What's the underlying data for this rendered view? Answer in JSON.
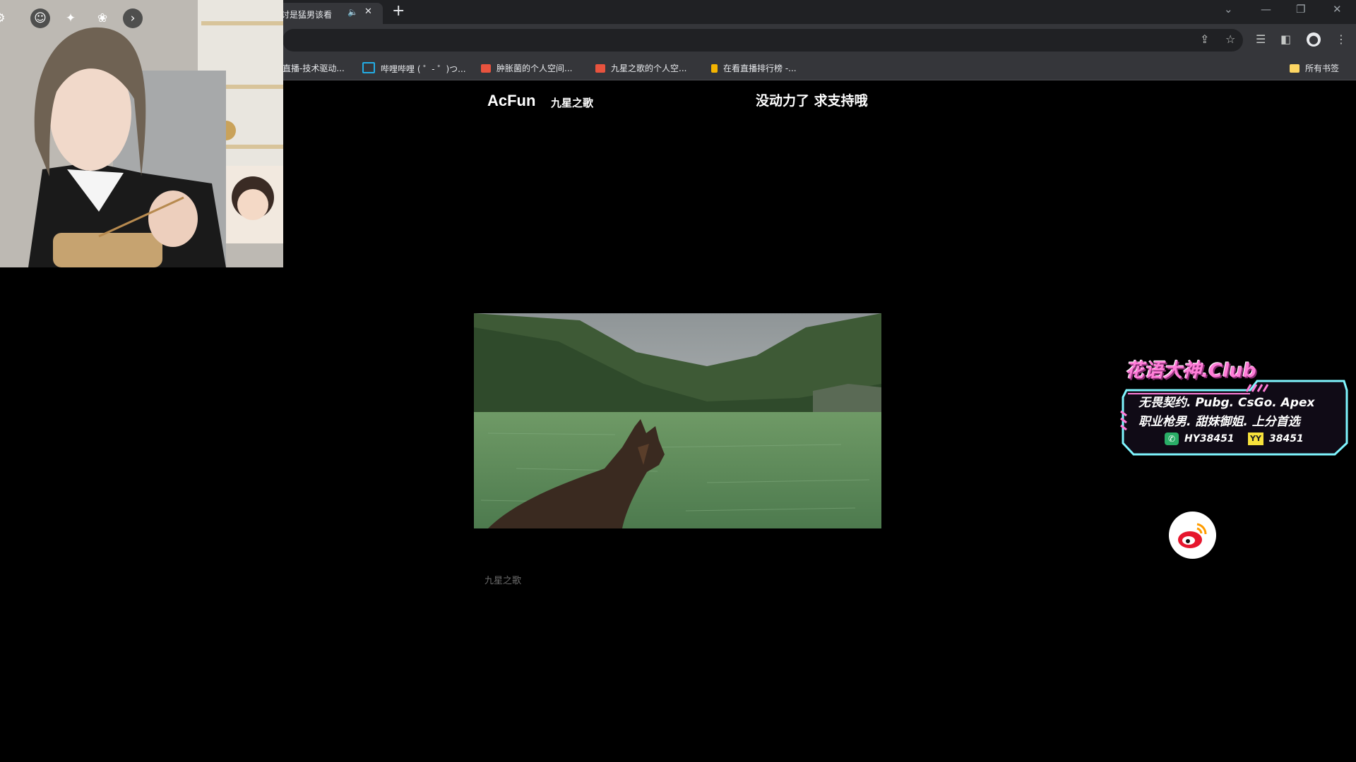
{
  "browser": {
    "tab_title": "讨是猛男该看",
    "tab_audio_icon": "speaker-icon",
    "new_tab_label": "+",
    "window_controls": [
      "⌄",
      "—",
      "❐",
      "✕"
    ]
  },
  "bookmarks": [
    {
      "label": "直播-技术驱动...",
      "color": "#e53935"
    },
    {
      "label": "哔哩哔哩 ( ゜- ゜)つ...",
      "color": "#23ade5"
    },
    {
      "label": "肿胀菌的个人空间...",
      "color": "#e8533e"
    },
    {
      "label": "九星之歌的个人空...",
      "color": "#e8533e"
    },
    {
      "label": "在看直播排行榜 -...",
      "color": "#f4b400"
    }
  ],
  "all_bookmarks_label": "所有书签",
  "page": {
    "logo_text": "AcFun",
    "logo_sub": "九星之歌",
    "headline": "没动力了 求支持哦",
    "credit": "九星之歌"
  },
  "promo": {
    "title": "花语大神.Club",
    "line1": "无畏契约. Pubg. CsGo. Apex",
    "line2": "职业枪男. 甜妹御姐. 上分首选",
    "wechat_id": "HY38451",
    "yy_id": "38451",
    "yy_label": "YY"
  },
  "colors": {
    "accent_pink": "#ff7dd8",
    "accent_cyan": "#7ff6ff",
    "tab_active": "#35363a",
    "chrome_dark": "#202124"
  }
}
